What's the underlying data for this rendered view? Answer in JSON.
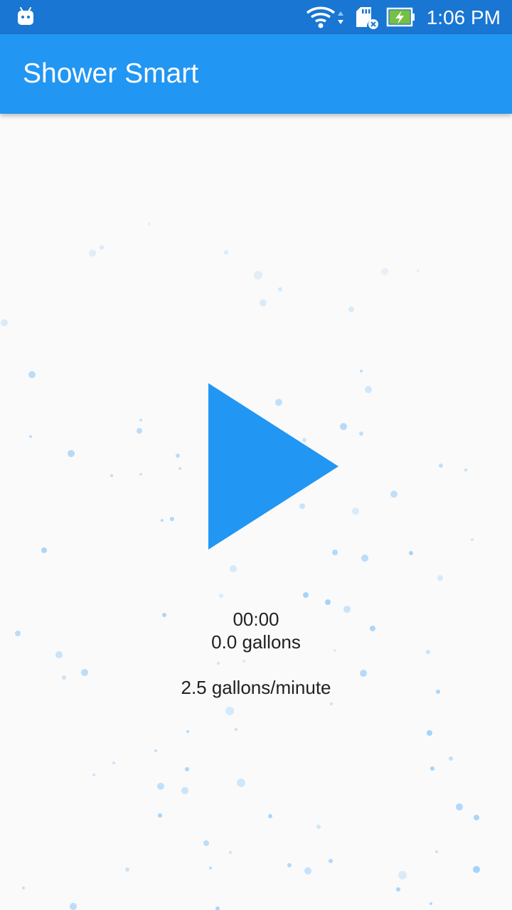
{
  "status_bar": {
    "time": "1:06 PM",
    "icons": [
      "android-icon",
      "wifi-icon",
      "sd-card-icon",
      "battery-charging-icon"
    ]
  },
  "app_bar": {
    "title": "Shower Smart",
    "color": "#2196f3"
  },
  "main": {
    "play_icon": "play-icon",
    "timer": "00:00",
    "gallons": "0.0 gallons",
    "flow_rate": "2.5 gallons/minute"
  },
  "colors": {
    "status_bar": "#1976d2",
    "accent": "#2196f3",
    "background": "#fafafa",
    "text": "#212121",
    "bubble": "#90caf9"
  }
}
